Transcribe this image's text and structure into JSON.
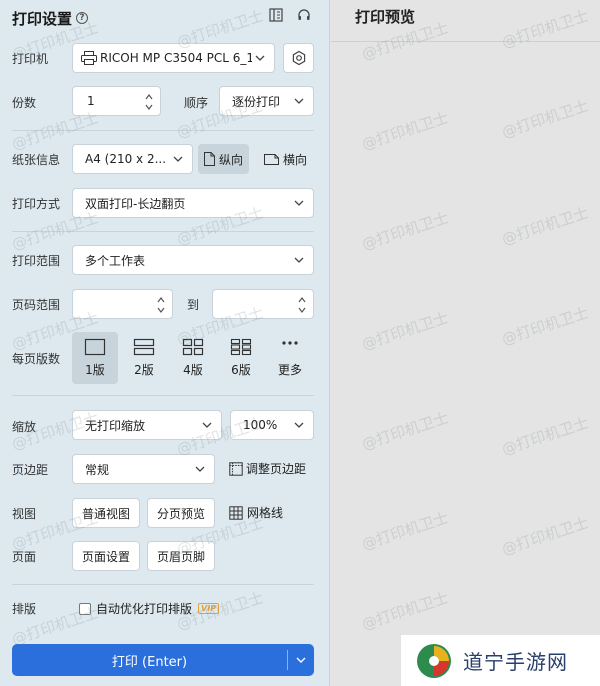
{
  "header": {
    "title": "打印设置",
    "help": "?"
  },
  "preview": {
    "title": "打印预览"
  },
  "labels": {
    "printer": "打印机",
    "copies": "份数",
    "order": "顺序",
    "paper": "纸张信息",
    "print_mode": "打印方式",
    "print_range": "打印范围",
    "page_range": "页码范围",
    "to": "到",
    "pages_per_sheet": "每页版数",
    "scale": "缩放",
    "margin": "页边距",
    "view": "视图",
    "page": "页面",
    "layout": "排版"
  },
  "fields": {
    "printer": "RICOH MP C3504 PCL 6_1",
    "copies": "1",
    "order": "逐份打印",
    "paper": "A4 (210 x 2...",
    "print_mode": "双面打印-长边翻页",
    "print_range": "多个工作表",
    "page_from": "",
    "page_to": "",
    "scale_mode": "无打印缩放",
    "scale_percent": "100%",
    "margin": "常规"
  },
  "orientation": {
    "portrait": "纵向",
    "landscape": "横向",
    "selected": "portrait"
  },
  "pages_per_sheet": [
    {
      "label": "1版",
      "icon": "one-page-icon",
      "selected": true
    },
    {
      "label": "2版",
      "icon": "two-pages-icon",
      "selected": false
    },
    {
      "label": "4版",
      "icon": "four-pages-icon",
      "selected": false
    },
    {
      "label": "6版",
      "icon": "six-pages-icon",
      "selected": false
    },
    {
      "label": "更多",
      "icon": "more-icon",
      "selected": false
    }
  ],
  "buttons": {
    "adjust_margin": "调整页边距",
    "normal_view": "普通视图",
    "page_break_preview": "分页预览",
    "gridlines": "网格线",
    "page_setup": "页面设置",
    "header_footer": "页眉页脚",
    "auto_optimize": "自动优化打印排版",
    "vip": "VIP",
    "print": "打印 (Enter)"
  },
  "watermark": "@打印机卫士",
  "logo": {
    "text": "道宁手游网"
  },
  "colors": {
    "accent": "#2b6fdc",
    "panel_bg": "#dde9ef",
    "vip": "#e2a23b"
  }
}
